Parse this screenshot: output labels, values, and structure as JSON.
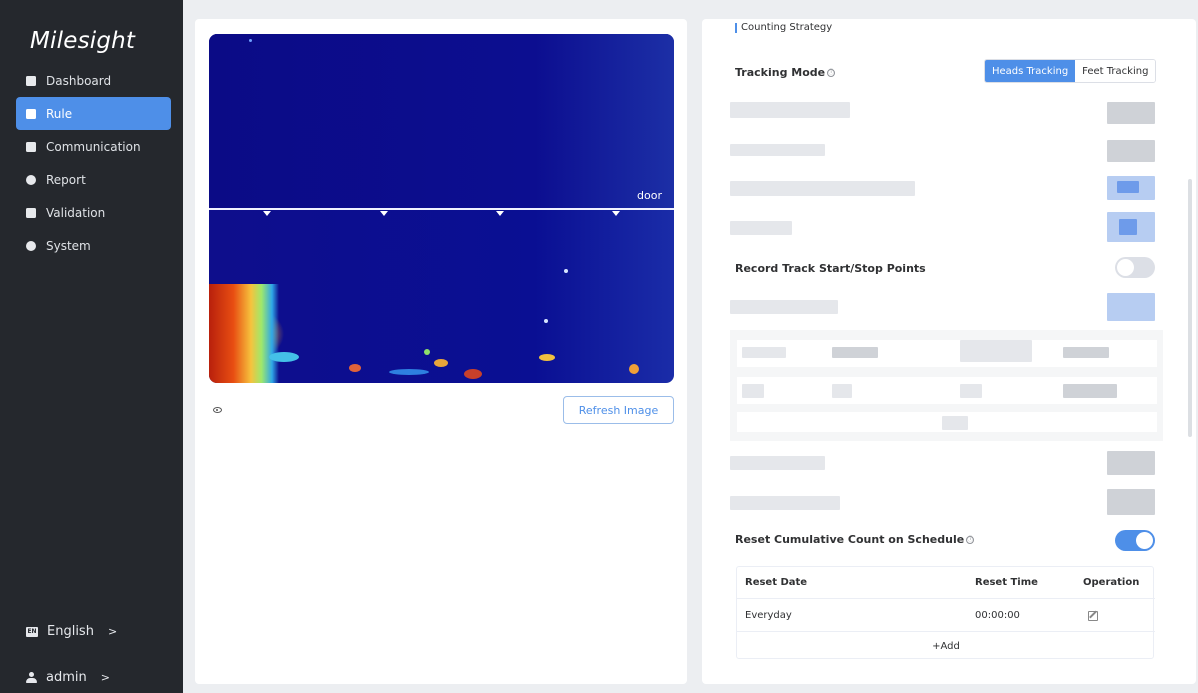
{
  "sidebar": {
    "logo": "Milesight",
    "items": [
      {
        "label": "Dashboard",
        "icon": "dashboard-icon",
        "active": false
      },
      {
        "label": "Rule",
        "icon": "rule-icon",
        "active": true
      },
      {
        "label": "Communication",
        "icon": "communication-icon",
        "active": false
      },
      {
        "label": "Report",
        "icon": "report-icon",
        "active": false
      },
      {
        "label": "Validation",
        "icon": "validation-icon",
        "active": false
      },
      {
        "label": "System",
        "icon": "system-icon",
        "active": false
      }
    ],
    "language": {
      "badge": "EN",
      "label": "English",
      "chevron": ">"
    },
    "user": {
      "label": "admin",
      "chevron": ">"
    }
  },
  "preview": {
    "door_label": "door",
    "refresh_label": "Refresh Image"
  },
  "settings": {
    "section_title": "Counting Strategy",
    "tracking_mode": {
      "label": "Tracking Mode",
      "info": "ⓘ",
      "options": [
        "Heads Tracking",
        "Feet Tracking"
      ],
      "selected": "Heads Tracking"
    },
    "record_track": {
      "label": "Record Track Start/Stop Points",
      "enabled": false
    },
    "reset_schedule": {
      "label": "Reset Cumulative Count on Schedule",
      "info": "ⓘ",
      "enabled": true
    },
    "schedule_table": {
      "headers": [
        "Reset Date",
        "Reset Time",
        "Operation"
      ],
      "rows": [
        {
          "date": "Everyday",
          "time": "00:00:00"
        }
      ],
      "add_label": "+Add"
    }
  },
  "colors": {
    "accent": "#4e8fe8",
    "sidebar_bg": "#25282d"
  }
}
